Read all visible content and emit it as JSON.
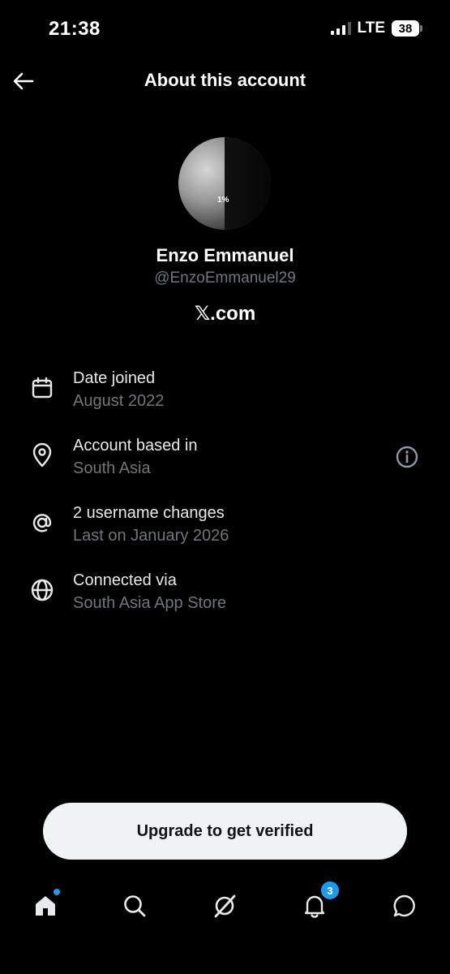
{
  "status_bar": {
    "time": "21:38",
    "network": "LTE",
    "battery": "38"
  },
  "header": {
    "title": "About this account",
    "back_icon": "arrow-left-icon"
  },
  "profile": {
    "name": "Enzo Emmanuel",
    "handle": "@EnzoEmmanuel29",
    "site_prefix": "𝕏",
    "site_suffix": ".com"
  },
  "info": [
    {
      "icon": "calendar-icon",
      "label": "Date joined",
      "value": "August 2022"
    },
    {
      "icon": "location-pin-icon",
      "label": "Account based in",
      "value": "South Asia"
    },
    {
      "icon": "at-sign-icon",
      "label": "2 username changes",
      "value": "Last on January 2026"
    },
    {
      "icon": "globe-icon",
      "label": "Connected via",
      "value": "South Asia App Store"
    }
  ],
  "cta": {
    "label": "Upgrade to get verified"
  },
  "tabbar": {
    "items": [
      {
        "icon": "home-icon",
        "has_dot": true
      },
      {
        "icon": "search-icon"
      },
      {
        "icon": "grok-icon"
      },
      {
        "icon": "bell-icon",
        "badge": "3"
      },
      {
        "icon": "chat-bubble-icon"
      }
    ]
  },
  "colors": {
    "background": "#000000",
    "text": "#e7e9ea",
    "muted": "#71767b",
    "accent": "#1d9bf0",
    "button_bg": "#eff3f4"
  }
}
